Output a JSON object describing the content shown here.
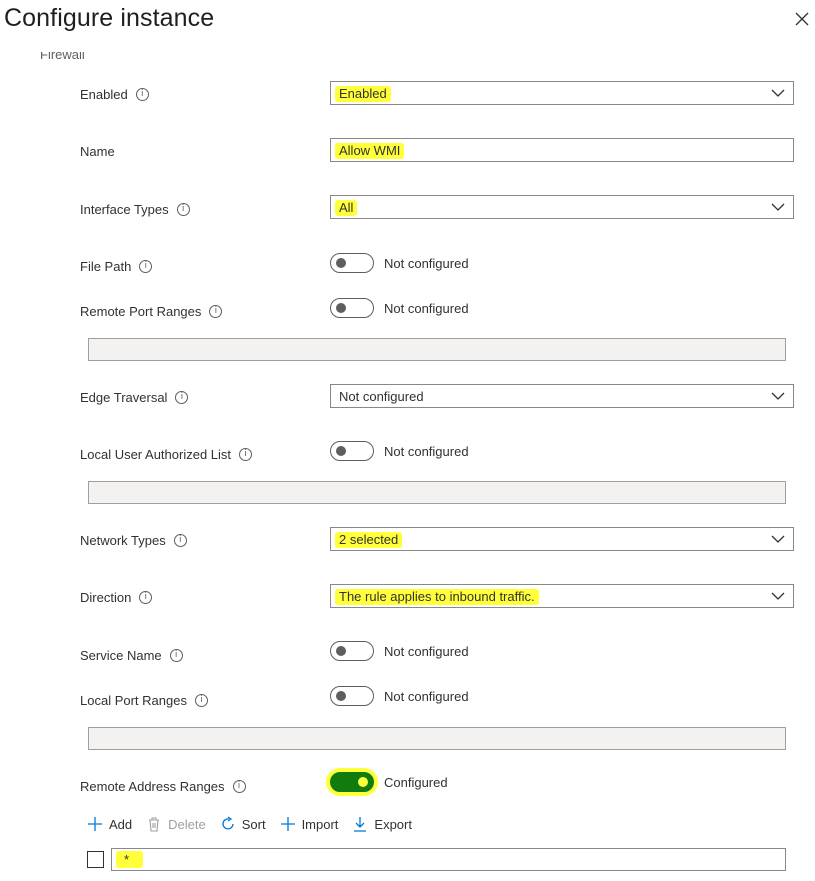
{
  "panel": {
    "title": "Configure instance",
    "section_cut": "Firewall"
  },
  "fields": {
    "enabled": {
      "label": "Enabled",
      "value": "Enabled"
    },
    "name": {
      "label": "Name",
      "value": "Allow WMI"
    },
    "interface_types": {
      "label": "Interface Types",
      "value": "All"
    },
    "file_path": {
      "label": "File Path",
      "state": "Not configured"
    },
    "remote_port_ranges": {
      "label": "Remote Port Ranges",
      "state": "Not configured"
    },
    "edge_traversal": {
      "label": "Edge Traversal",
      "value": "Not configured"
    },
    "local_user_authorized_list": {
      "label": "Local User Authorized List",
      "state": "Not configured"
    },
    "network_types": {
      "label": "Network Types",
      "value": "2 selected"
    },
    "direction": {
      "label": "Direction",
      "value": "The rule applies to inbound traffic."
    },
    "service_name": {
      "label": "Service Name",
      "state": "Not configured"
    },
    "local_port_ranges": {
      "label": "Local Port Ranges",
      "state": "Not configured"
    },
    "remote_address_ranges": {
      "label": "Remote Address Ranges",
      "state": "Configured"
    }
  },
  "commands": {
    "add": "Add",
    "delete": "Delete",
    "sort": "Sort",
    "import": "Import",
    "export": "Export"
  },
  "address_list": {
    "rows": [
      {
        "value": "*"
      }
    ]
  },
  "info_glyph": "i",
  "colors": {
    "highlight": "#ffff3a",
    "toggle_on": "#107c10",
    "border": "#8a8886",
    "disabled_bg": "#f3f2f1",
    "link_blue": "#0078d4"
  }
}
